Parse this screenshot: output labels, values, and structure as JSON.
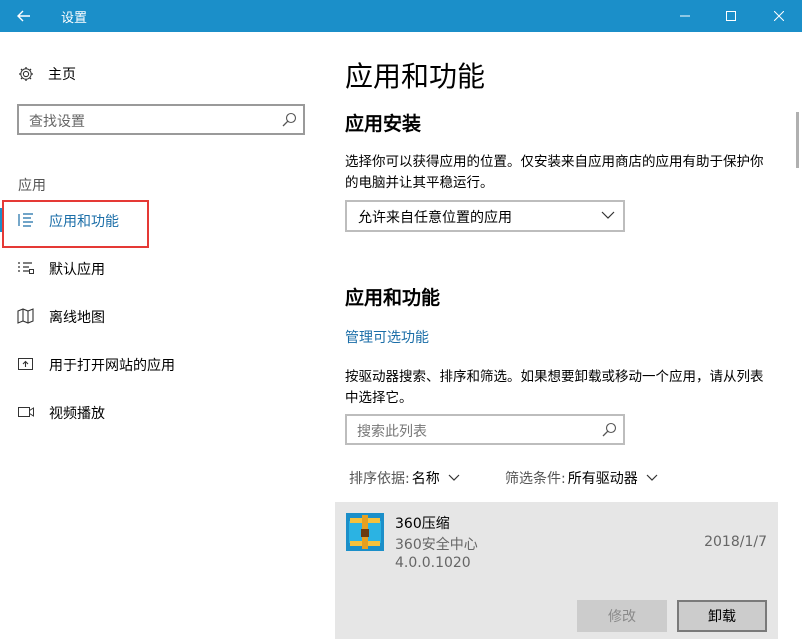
{
  "window": {
    "title": "设置",
    "colors": {
      "titlebar": "#1b8fc9",
      "accent_text": "#1b6ea8",
      "highlight_box": "#e53935"
    }
  },
  "sidebar": {
    "home_label": "主页",
    "search_placeholder": "查找设置",
    "section_label": "应用",
    "items": [
      {
        "label": "应用和功能",
        "icon": "list-icon",
        "active": true
      },
      {
        "label": "默认应用",
        "icon": "default-apps-icon",
        "active": false
      },
      {
        "label": "离线地图",
        "icon": "map-icon",
        "active": false
      },
      {
        "label": "用于打开网站的应用",
        "icon": "open-website-icon",
        "active": false
      },
      {
        "label": "视频播放",
        "icon": "video-icon",
        "active": false
      }
    ]
  },
  "main": {
    "title": "应用和功能",
    "install_section": {
      "heading": "应用安装",
      "description": "选择你可以获得应用的位置。仅安装来自应用商店的应用有助于保护你的电脑并让其平稳运行。",
      "dropdown_value": "允许来自任意位置的应用"
    },
    "apps_section": {
      "heading": "应用和功能",
      "manage_link": "管理可选功能",
      "description": "按驱动器搜索、排序和筛选。如果想要卸载或移动一个应用，请从列表中选择它。",
      "search_placeholder": "搜索此列表",
      "sort_label": "排序依据:",
      "sort_value": "名称",
      "filter_label": "筛选条件:",
      "filter_value": "所有驱动器"
    },
    "app_list": [
      {
        "name": "360压缩",
        "publisher": "360安全中心",
        "version": "4.0.0.1020",
        "date": "2018/1/7",
        "modify_label": "修改",
        "uninstall_label": "卸载"
      }
    ]
  }
}
